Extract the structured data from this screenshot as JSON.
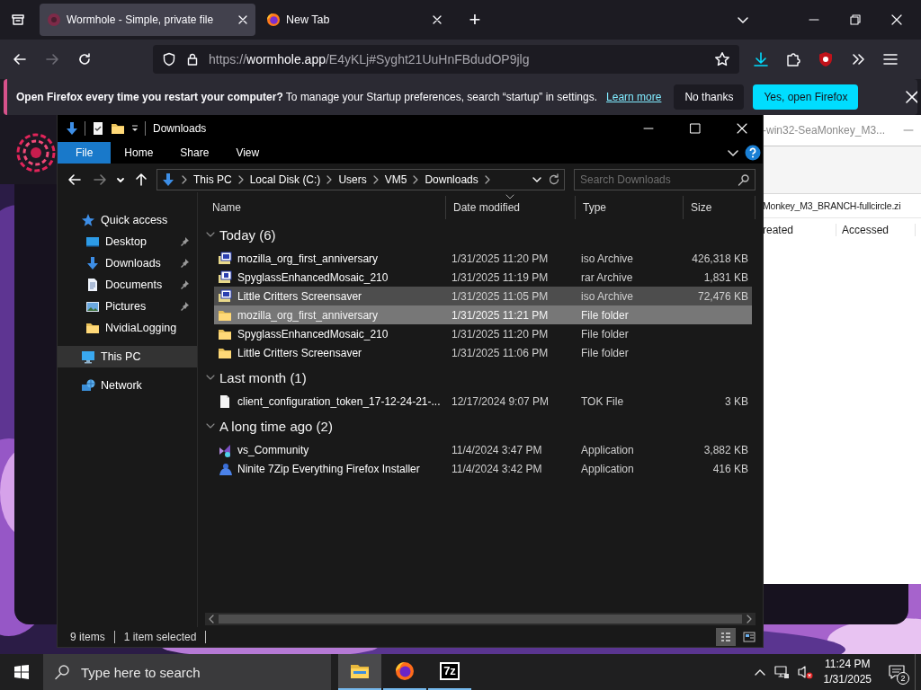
{
  "browser": {
    "tabs": [
      {
        "title": "Wormhole - Simple, private file",
        "kind": "wormhole",
        "selected": true
      },
      {
        "title": "New Tab",
        "kind": "firefox",
        "selected": false
      }
    ],
    "new_tab": "+",
    "nav": [
      {
        "kind": "back",
        "disabled": false
      },
      {
        "kind": "forward",
        "disabled": true
      },
      {
        "kind": "reload",
        "disabled": false
      }
    ],
    "url": {
      "scheme": "https://",
      "host": "wormhole.app",
      "path": "/E4yKLj#Syght21UuHnFBdudOP9jlg"
    },
    "notification": {
      "message": "**Open Firefox every time you restart your computer?** To manage your Startup preferences, search “startup” in settings.",
      "link": "Learn more",
      "buttons": [
        {
          "label": "No thanks",
          "kind": "secondary"
        },
        {
          "label": "Yes, open Firefox",
          "kind": "primary"
        }
      ]
    }
  },
  "background_window": {
    "title": "-win32-SeaMonkey_M3...",
    "path": "Monkey_M3_BRANCH-fullcircle.zi",
    "columns": [
      "reated",
      "Accessed"
    ]
  },
  "explorer": {
    "title": "Downloads",
    "ribbon_tabs": [
      {
        "label": "File",
        "selected": true
      },
      {
        "label": "Home",
        "selected": false
      },
      {
        "label": "Share",
        "selected": false
      },
      {
        "label": "View",
        "selected": false
      }
    ],
    "nav": [
      {
        "kind": "back",
        "disabled": false
      },
      {
        "kind": "forward",
        "disabled": true
      },
      {
        "kind": "recent",
        "disabled": false
      },
      {
        "kind": "up",
        "disabled": false
      }
    ],
    "breadcrumbs": [
      "This PC",
      "Local Disk (C:)",
      "Users",
      "VM5",
      "Downloads"
    ],
    "search": {
      "placeholder": "Search Downloads"
    },
    "sidebar": [
      {
        "label": "Quick access",
        "kind": "star",
        "selected": false,
        "children": [
          {
            "label": "Desktop",
            "kind": "desktop",
            "pinned": true,
            "selected": false
          },
          {
            "label": "Downloads",
            "kind": "download",
            "pinned": true,
            "selected": false
          },
          {
            "label": "Documents",
            "kind": "documents",
            "pinned": true,
            "selected": false
          },
          {
            "label": "Pictures",
            "kind": "pictures",
            "pinned": true,
            "selected": false
          },
          {
            "label": "NvidiaLogging",
            "kind": "folder",
            "pinned": false,
            "selected": false
          }
        ]
      },
      {
        "label": "This PC",
        "kind": "pc",
        "selected": true
      },
      {
        "label": "Network",
        "kind": "network",
        "selected": false
      }
    ],
    "columns": [
      {
        "label": "Name",
        "sorted": false
      },
      {
        "label": "Date modified",
        "sorted": true
      },
      {
        "label": "Type",
        "sorted": false
      },
      {
        "label": "Size",
        "sorted": false
      }
    ],
    "groups": [
      {
        "label": "Today (6)",
        "expanded": true,
        "rows": [
          {
            "kind": "iso",
            "name": "mozilla_org_first_anniversary",
            "date": "1/31/2025 11:20 PM",
            "type": "iso Archive",
            "size": "426,318 KB",
            "selected": false,
            "hovered": false
          },
          {
            "kind": "rar",
            "name": "SpyglassEnhancedMosaic_210",
            "date": "1/31/2025 11:19 PM",
            "type": "rar Archive",
            "size": "1,831 KB",
            "selected": false,
            "hovered": false
          },
          {
            "kind": "iso",
            "name": "Little Critters Screensaver",
            "date": "1/31/2025 11:05 PM",
            "type": "iso Archive",
            "size": "72,476 KB",
            "selected": false,
            "hovered": true
          },
          {
            "kind": "folder",
            "name": "mozilla_org_first_anniversary",
            "date": "1/31/2025 11:21 PM",
            "type": "File folder",
            "selected": true,
            "hovered": false
          },
          {
            "kind": "folder",
            "name": "SpyglassEnhancedMosaic_210",
            "date": "1/31/2025 11:20 PM",
            "type": "File folder",
            "selected": false,
            "hovered": false
          },
          {
            "kind": "folder",
            "name": "Little Critters Screensaver",
            "date": "1/31/2025 11:06 PM",
            "type": "File folder",
            "selected": false,
            "hovered": false
          }
        ]
      },
      {
        "label": "Last month (1)",
        "expanded": true,
        "rows": [
          {
            "kind": "file",
            "name": "client_configuration_token_17-12-24-21-...",
            "date": "12/17/2024 9:07 PM",
            "type": "TOK File",
            "size": "3 KB",
            "selected": false,
            "hovered": false
          }
        ]
      },
      {
        "label": "A long time ago (2)",
        "expanded": true,
        "rows": [
          {
            "kind": "vs",
            "name": "vs_Community",
            "date": "11/4/2024 3:47 PM",
            "type": "Application",
            "size": "3,882 KB",
            "selected": false,
            "hovered": false
          },
          {
            "kind": "installer",
            "name": "Ninite 7Zip Everything Firefox Installer",
            "date": "11/4/2024 3:42 PM",
            "type": "Application",
            "size": "416 KB",
            "selected": false,
            "hovered": false
          }
        ]
      }
    ],
    "status_bar": {
      "items": [
        "9 items",
        "1 item selected"
      ],
      "views": [
        {
          "kind": "details",
          "selected": true
        },
        {
          "kind": "tiles",
          "selected": false
        }
      ]
    }
  },
  "taskbar": {
    "search": {
      "placeholder": "Type here to search"
    },
    "apps": [
      {
        "kind": "explorer",
        "active": true
      },
      {
        "kind": "firefox",
        "active": false
      },
      {
        "kind": "sevenzip",
        "label": "7z",
        "active": false
      }
    ],
    "time": "11:24 PM",
    "date": "1/31/2025",
    "notifications": "2"
  }
}
